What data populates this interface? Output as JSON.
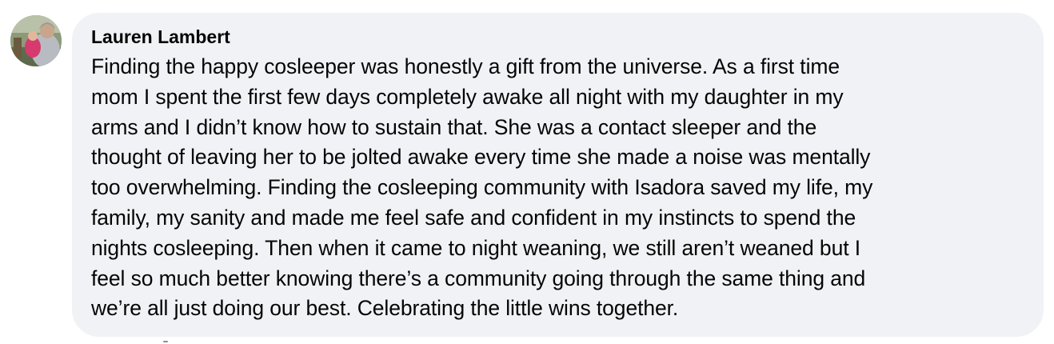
{
  "comment": {
    "author": "Lauren Lambert",
    "avatar_icon": "user-photo-avatar",
    "lines": [
      "Finding the happy cosleeper was honestly a gift from the universe. As a first time",
      "mom I spent the first few days completely awake all night with my daughter in my",
      "arms and I didn’t know how to sustain that. She was a contact sleeper and the",
      "thought of leaving her to be jolted awake every time she made a noise was mentally",
      "too overwhelming. Finding the cosleeping community with Isadora saved my life, my",
      "family, my sanity and made me feel safe and confident in my instincts to spend the",
      "nights cosleeping. Then when it came to night weaning, we still aren’t weaned but I",
      "feel so much better knowing there’s a community going through the same thing and",
      "we’re all just doing our best. Celebrating the little wins together."
    ]
  },
  "colors": {
    "bubble_bg": "#f0f2f5",
    "text": "#050505",
    "page_bg": "#ffffff"
  }
}
